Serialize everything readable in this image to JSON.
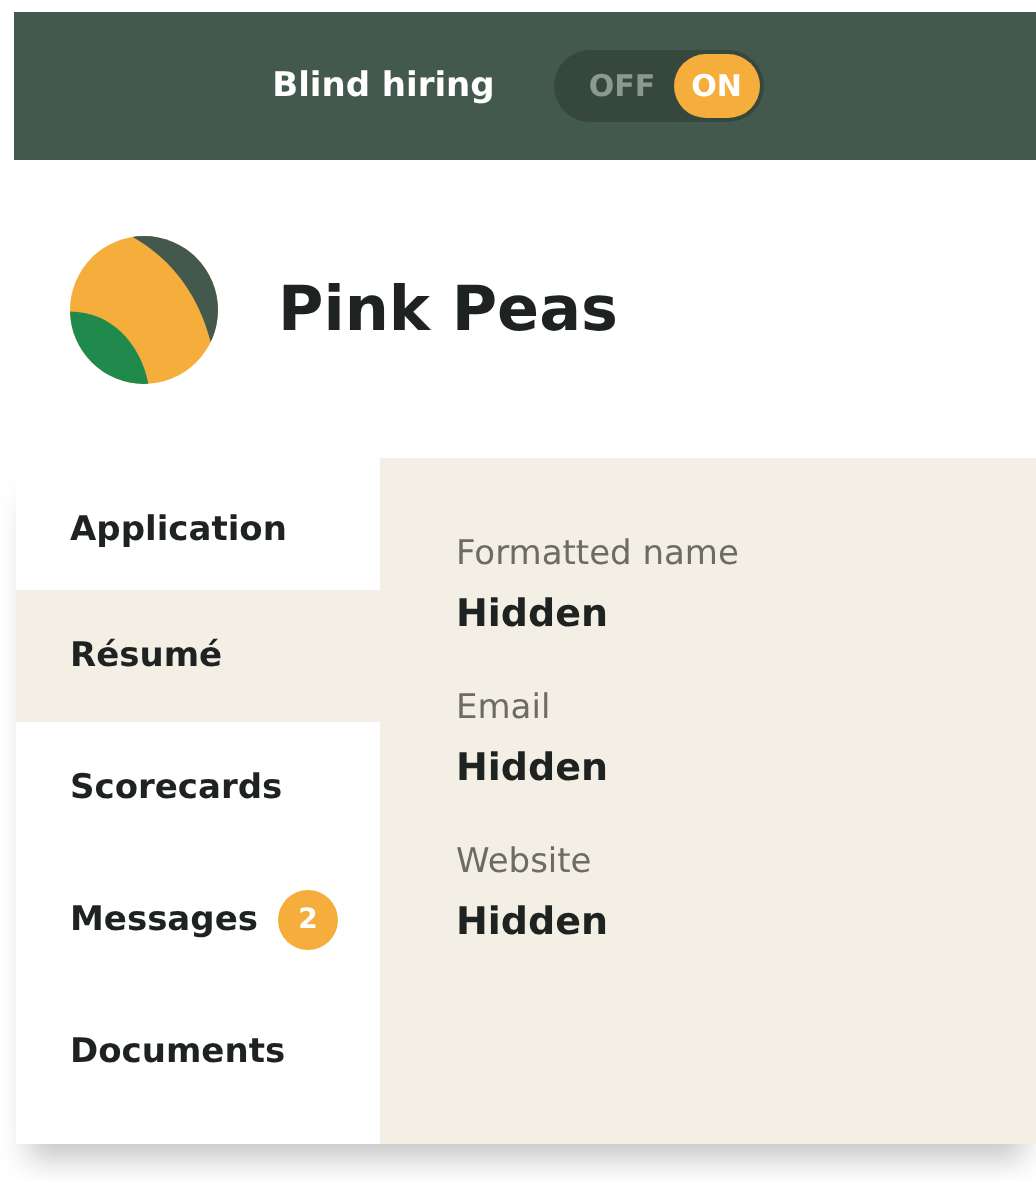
{
  "top_bar": {
    "label": "Blind hiring",
    "toggle": {
      "off_label": "OFF",
      "on_label": "ON",
      "on": true
    }
  },
  "profile": {
    "name": "Pink Peas"
  },
  "sidebar": {
    "items": [
      {
        "label": "Application",
        "selected": false
      },
      {
        "label": "Résumé",
        "selected": true
      },
      {
        "label": "Scorecards",
        "selected": false
      },
      {
        "label": "Messages",
        "selected": false,
        "badge": "2"
      },
      {
        "label": "Documents",
        "selected": false
      }
    ]
  },
  "fields": [
    {
      "label": "Formatted name",
      "value": "Hidden"
    },
    {
      "label": "Email",
      "value": "Hidden"
    },
    {
      "label": "Website",
      "value": "Hidden"
    }
  ]
}
